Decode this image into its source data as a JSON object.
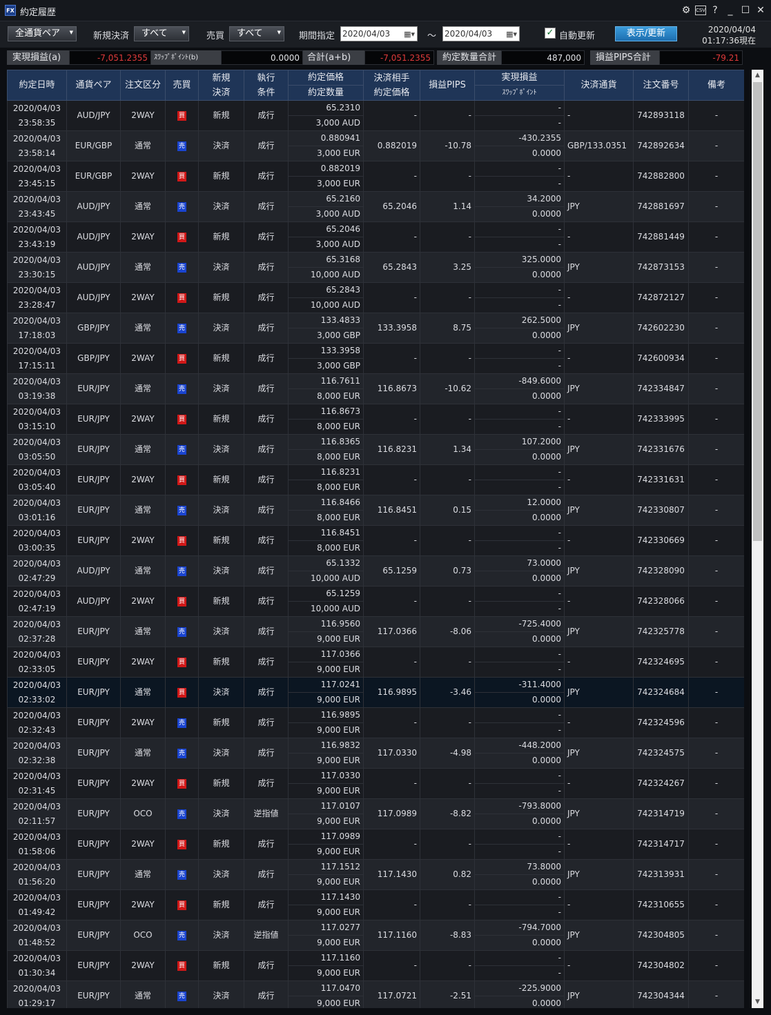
{
  "window": {
    "title": "約定履歴",
    "app_icon_text": "FX",
    "controls": [
      "⚙",
      "CSV",
      "?",
      "_",
      "☐",
      "✕"
    ]
  },
  "toolbar": {
    "pair_filter": "全通貨ペア",
    "new_settle_label": "新規決済",
    "new_settle_value": "すべて",
    "side_label": "売買",
    "side_value": "すべて",
    "period_label": "期間指定",
    "date_from": "2020/04/03",
    "tilde": "～",
    "date_to": "2020/04/03",
    "auto_refresh_label": "自動更新",
    "auto_refresh_checked": true,
    "refresh_button": "表示/更新",
    "now_date": "2020/04/04",
    "now_time": "01:17:36現在"
  },
  "summary": {
    "realized_label": "実現損益(a)",
    "realized_value": "-7,051.2355",
    "swap_label": "ｽﾜｯﾌﾟﾎﾟｲﾝﾄ(b)",
    "swap_value": "0.0000",
    "total_label": "合計(a+b)",
    "total_value": "-7,051.2355",
    "qty_label": "約定数量合計",
    "qty_value": "487,000",
    "pips_label": "損益PIPS合計",
    "pips_value": "-79.21"
  },
  "headers": {
    "datetime": "約定日時",
    "pair": "通貨ペア",
    "order_type": "注文区分",
    "side": "売買",
    "newsettle_1": "新規",
    "newsettle_2": "決済",
    "exec_1": "執行",
    "exec_2": "条件",
    "price_1": "約定価格",
    "price_2": "約定数量",
    "cp_1": "決済相手",
    "cp_2": "約定価格",
    "pips": "損益PIPS",
    "pl_1": "実現損益",
    "pl_2": "ｽﾜｯﾌﾟﾎﾟｲﾝﾄ",
    "settle_ccy": "決済通貨",
    "order_no": "注文番号",
    "note": "備考"
  },
  "badges": {
    "buy": "買",
    "sell": "売"
  },
  "rows": [
    {
      "date": "2020/04/03",
      "time": "23:58:35",
      "pair": "AUD/JPY",
      "type": "2WAY",
      "side": "buy",
      "ns": "新規",
      "exec": "成行",
      "price": "65.2310",
      "qty": "3,000 AUD",
      "cp": "-",
      "pips": "-",
      "pl": "-",
      "swap": "-",
      "ccy": "-",
      "no": "742893118",
      "note": "-"
    },
    {
      "date": "2020/04/03",
      "time": "23:58:14",
      "pair": "EUR/GBP",
      "type": "通常",
      "side": "sell",
      "ns": "決済",
      "exec": "成行",
      "price": "0.880941",
      "qty": "3,000 EUR",
      "cp": "0.882019",
      "pips": "-10.78",
      "pl": "-430.2355",
      "swap": "0.0000",
      "ccy": "GBP/133.0351",
      "no": "742892634",
      "note": "-"
    },
    {
      "date": "2020/04/03",
      "time": "23:45:15",
      "pair": "EUR/GBP",
      "type": "2WAY",
      "side": "buy",
      "ns": "新規",
      "exec": "成行",
      "price": "0.882019",
      "qty": "3,000 EUR",
      "cp": "-",
      "pips": "-",
      "pl": "-",
      "swap": "-",
      "ccy": "-",
      "no": "742882800",
      "note": "-"
    },
    {
      "date": "2020/04/03",
      "time": "23:43:45",
      "pair": "AUD/JPY",
      "type": "通常",
      "side": "sell",
      "ns": "決済",
      "exec": "成行",
      "price": "65.2160",
      "qty": "3,000 AUD",
      "cp": "65.2046",
      "pips": "1.14",
      "pl": "34.2000",
      "swap": "0.0000",
      "ccy": "JPY",
      "no": "742881697",
      "note": "-"
    },
    {
      "date": "2020/04/03",
      "time": "23:43:19",
      "pair": "AUD/JPY",
      "type": "2WAY",
      "side": "buy",
      "ns": "新規",
      "exec": "成行",
      "price": "65.2046",
      "qty": "3,000 AUD",
      "cp": "-",
      "pips": "-",
      "pl": "-",
      "swap": "-",
      "ccy": "-",
      "no": "742881449",
      "note": "-"
    },
    {
      "date": "2020/04/03",
      "time": "23:30:15",
      "pair": "AUD/JPY",
      "type": "通常",
      "side": "sell",
      "ns": "決済",
      "exec": "成行",
      "price": "65.3168",
      "qty": "10,000 AUD",
      "cp": "65.2843",
      "pips": "3.25",
      "pl": "325.0000",
      "swap": "0.0000",
      "ccy": "JPY",
      "no": "742873153",
      "note": "-"
    },
    {
      "date": "2020/04/03",
      "time": "23:28:47",
      "pair": "AUD/JPY",
      "type": "2WAY",
      "side": "buy",
      "ns": "新規",
      "exec": "成行",
      "price": "65.2843",
      "qty": "10,000 AUD",
      "cp": "-",
      "pips": "-",
      "pl": "-",
      "swap": "-",
      "ccy": "-",
      "no": "742872127",
      "note": "-"
    },
    {
      "date": "2020/04/03",
      "time": "17:18:03",
      "pair": "GBP/JPY",
      "type": "通常",
      "side": "sell",
      "ns": "決済",
      "exec": "成行",
      "price": "133.4833",
      "qty": "3,000 GBP",
      "cp": "133.3958",
      "pips": "8.75",
      "pl": "262.5000",
      "swap": "0.0000",
      "ccy": "JPY",
      "no": "742602230",
      "note": "-"
    },
    {
      "date": "2020/04/03",
      "time": "17:15:11",
      "pair": "GBP/JPY",
      "type": "2WAY",
      "side": "buy",
      "ns": "新規",
      "exec": "成行",
      "price": "133.3958",
      "qty": "3,000 GBP",
      "cp": "-",
      "pips": "-",
      "pl": "-",
      "swap": "-",
      "ccy": "-",
      "no": "742600934",
      "note": "-"
    },
    {
      "date": "2020/04/03",
      "time": "03:19:38",
      "pair": "EUR/JPY",
      "type": "通常",
      "side": "sell",
      "ns": "決済",
      "exec": "成行",
      "price": "116.7611",
      "qty": "8,000 EUR",
      "cp": "116.8673",
      "pips": "-10.62",
      "pl": "-849.6000",
      "swap": "0.0000",
      "ccy": "JPY",
      "no": "742334847",
      "note": "-"
    },
    {
      "date": "2020/04/03",
      "time": "03:15:10",
      "pair": "EUR/JPY",
      "type": "2WAY",
      "side": "buy",
      "ns": "新規",
      "exec": "成行",
      "price": "116.8673",
      "qty": "8,000 EUR",
      "cp": "-",
      "pips": "-",
      "pl": "-",
      "swap": "-",
      "ccy": "-",
      "no": "742333995",
      "note": "-"
    },
    {
      "date": "2020/04/03",
      "time": "03:05:50",
      "pair": "EUR/JPY",
      "type": "通常",
      "side": "sell",
      "ns": "決済",
      "exec": "成行",
      "price": "116.8365",
      "qty": "8,000 EUR",
      "cp": "116.8231",
      "pips": "1.34",
      "pl": "107.2000",
      "swap": "0.0000",
      "ccy": "JPY",
      "no": "742331676",
      "note": "-"
    },
    {
      "date": "2020/04/03",
      "time": "03:05:40",
      "pair": "EUR/JPY",
      "type": "2WAY",
      "side": "buy",
      "ns": "新規",
      "exec": "成行",
      "price": "116.8231",
      "qty": "8,000 EUR",
      "cp": "-",
      "pips": "-",
      "pl": "-",
      "swap": "-",
      "ccy": "-",
      "no": "742331631",
      "note": "-"
    },
    {
      "date": "2020/04/03",
      "time": "03:01:16",
      "pair": "EUR/JPY",
      "type": "通常",
      "side": "sell",
      "ns": "決済",
      "exec": "成行",
      "price": "116.8466",
      "qty": "8,000 EUR",
      "cp": "116.8451",
      "pips": "0.15",
      "pl": "12.0000",
      "swap": "0.0000",
      "ccy": "JPY",
      "no": "742330807",
      "note": "-"
    },
    {
      "date": "2020/04/03",
      "time": "03:00:35",
      "pair": "EUR/JPY",
      "type": "2WAY",
      "side": "buy",
      "ns": "新規",
      "exec": "成行",
      "price": "116.8451",
      "qty": "8,000 EUR",
      "cp": "-",
      "pips": "-",
      "pl": "-",
      "swap": "-",
      "ccy": "-",
      "no": "742330669",
      "note": "-"
    },
    {
      "date": "2020/04/03",
      "time": "02:47:29",
      "pair": "AUD/JPY",
      "type": "通常",
      "side": "sell",
      "ns": "決済",
      "exec": "成行",
      "price": "65.1332",
      "qty": "10,000 AUD",
      "cp": "65.1259",
      "pips": "0.73",
      "pl": "73.0000",
      "swap": "0.0000",
      "ccy": "JPY",
      "no": "742328090",
      "note": "-"
    },
    {
      "date": "2020/04/03",
      "time": "02:47:19",
      "pair": "AUD/JPY",
      "type": "2WAY",
      "side": "buy",
      "ns": "新規",
      "exec": "成行",
      "price": "65.1259",
      "qty": "10,000 AUD",
      "cp": "-",
      "pips": "-",
      "pl": "-",
      "swap": "-",
      "ccy": "-",
      "no": "742328066",
      "note": "-"
    },
    {
      "date": "2020/04/03",
      "time": "02:37:28",
      "pair": "EUR/JPY",
      "type": "通常",
      "side": "sell",
      "ns": "決済",
      "exec": "成行",
      "price": "116.9560",
      "qty": "9,000 EUR",
      "cp": "117.0366",
      "pips": "-8.06",
      "pl": "-725.4000",
      "swap": "0.0000",
      "ccy": "JPY",
      "no": "742325778",
      "note": "-"
    },
    {
      "date": "2020/04/03",
      "time": "02:33:05",
      "pair": "EUR/JPY",
      "type": "2WAY",
      "side": "buy",
      "ns": "新規",
      "exec": "成行",
      "price": "117.0366",
      "qty": "9,000 EUR",
      "cp": "-",
      "pips": "-",
      "pl": "-",
      "swap": "-",
      "ccy": "-",
      "no": "742324695",
      "note": "-"
    },
    {
      "date": "2020/04/03",
      "time": "02:33:02",
      "pair": "EUR/JPY",
      "type": "通常",
      "side": "buy",
      "ns": "決済",
      "exec": "成行",
      "price": "117.0241",
      "qty": "9,000 EUR",
      "cp": "116.9895",
      "pips": "-3.46",
      "pl": "-311.4000",
      "swap": "0.0000",
      "ccy": "JPY",
      "no": "742324684",
      "note": "-",
      "selected": true
    },
    {
      "date": "2020/04/03",
      "time": "02:32:43",
      "pair": "EUR/JPY",
      "type": "2WAY",
      "side": "sell",
      "ns": "新規",
      "exec": "成行",
      "price": "116.9895",
      "qty": "9,000 EUR",
      "cp": "-",
      "pips": "-",
      "pl": "-",
      "swap": "-",
      "ccy": "-",
      "no": "742324596",
      "note": "-"
    },
    {
      "date": "2020/04/03",
      "time": "02:32:38",
      "pair": "EUR/JPY",
      "type": "通常",
      "side": "sell",
      "ns": "決済",
      "exec": "成行",
      "price": "116.9832",
      "qty": "9,000 EUR",
      "cp": "117.0330",
      "pips": "-4.98",
      "pl": "-448.2000",
      "swap": "0.0000",
      "ccy": "JPY",
      "no": "742324575",
      "note": "-"
    },
    {
      "date": "2020/04/03",
      "time": "02:31:45",
      "pair": "EUR/JPY",
      "type": "2WAY",
      "side": "buy",
      "ns": "新規",
      "exec": "成行",
      "price": "117.0330",
      "qty": "9,000 EUR",
      "cp": "-",
      "pips": "-",
      "pl": "-",
      "swap": "-",
      "ccy": "-",
      "no": "742324267",
      "note": "-"
    },
    {
      "date": "2020/04/03",
      "time": "02:11:57",
      "pair": "EUR/JPY",
      "type": "OCO",
      "side": "sell",
      "ns": "決済",
      "exec": "逆指値",
      "price": "117.0107",
      "qty": "9,000 EUR",
      "cp": "117.0989",
      "pips": "-8.82",
      "pl": "-793.8000",
      "swap": "0.0000",
      "ccy": "JPY",
      "no": "742314719",
      "note": "-"
    },
    {
      "date": "2020/04/03",
      "time": "01:58:06",
      "pair": "EUR/JPY",
      "type": "2WAY",
      "side": "buy",
      "ns": "新規",
      "exec": "成行",
      "price": "117.0989",
      "qty": "9,000 EUR",
      "cp": "-",
      "pips": "-",
      "pl": "-",
      "swap": "-",
      "ccy": "-",
      "no": "742314717",
      "note": "-"
    },
    {
      "date": "2020/04/03",
      "time": "01:56:20",
      "pair": "EUR/JPY",
      "type": "通常",
      "side": "sell",
      "ns": "決済",
      "exec": "成行",
      "price": "117.1512",
      "qty": "9,000 EUR",
      "cp": "117.1430",
      "pips": "0.82",
      "pl": "73.8000",
      "swap": "0.0000",
      "ccy": "JPY",
      "no": "742313931",
      "note": "-"
    },
    {
      "date": "2020/04/03",
      "time": "01:49:42",
      "pair": "EUR/JPY",
      "type": "2WAY",
      "side": "buy",
      "ns": "新規",
      "exec": "成行",
      "price": "117.1430",
      "qty": "9,000 EUR",
      "cp": "-",
      "pips": "-",
      "pl": "-",
      "swap": "-",
      "ccy": "-",
      "no": "742310655",
      "note": "-"
    },
    {
      "date": "2020/04/03",
      "time": "01:48:52",
      "pair": "EUR/JPY",
      "type": "OCO",
      "side": "sell",
      "ns": "決済",
      "exec": "逆指値",
      "price": "117.0277",
      "qty": "9,000 EUR",
      "cp": "117.1160",
      "pips": "-8.83",
      "pl": "-794.7000",
      "swap": "0.0000",
      "ccy": "JPY",
      "no": "742304805",
      "note": "-"
    },
    {
      "date": "2020/04/03",
      "time": "01:30:34",
      "pair": "EUR/JPY",
      "type": "2WAY",
      "side": "buy",
      "ns": "新規",
      "exec": "成行",
      "price": "117.1160",
      "qty": "9,000 EUR",
      "cp": "-",
      "pips": "-",
      "pl": "-",
      "swap": "-",
      "ccy": "-",
      "no": "742304802",
      "note": "-"
    },
    {
      "date": "2020/04/03",
      "time": "01:29:17",
      "pair": "EUR/JPY",
      "type": "通常",
      "side": "sell",
      "ns": "決済",
      "exec": "成行",
      "price": "117.0470",
      "qty": "9,000 EUR",
      "cp": "117.0721",
      "pips": "-2.51",
      "pl": "-225.9000",
      "swap": "0.0000",
      "ccy": "JPY",
      "no": "742304344",
      "note": "-"
    }
  ]
}
